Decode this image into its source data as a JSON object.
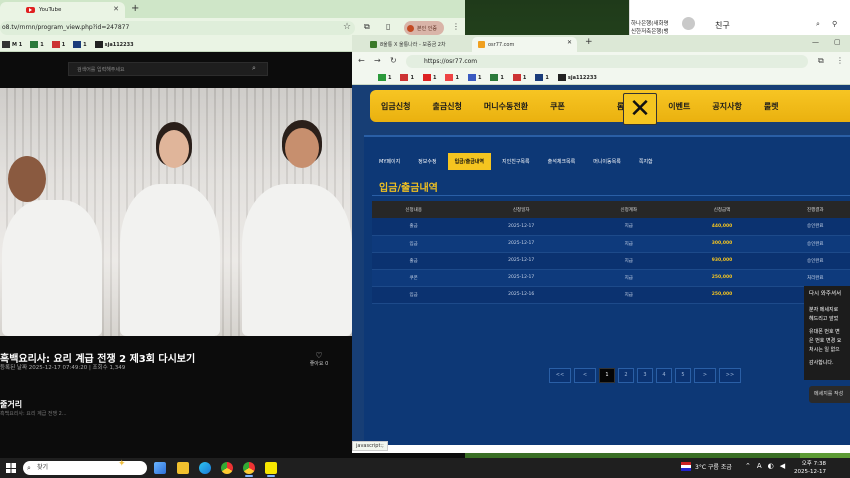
{
  "left_browser": {
    "tab_title": "YouTube",
    "url": "o8.tv/rnrnn/program_view.php?id=247877",
    "profile_pill": "본인 인증",
    "bookmarks": [
      "M 1",
      "1",
      "1",
      "1",
      "sja112233"
    ],
    "search_placeholder": "검색어를 입력해주세요",
    "video_title": "흑백요리사: 요리 계급 전쟁 2 제3회 다시보기",
    "video_meta": "등록된 날짜 2025-12-17 07:49:20 | 조회수 1,349",
    "like_label": "좋아요 0",
    "section_title": "줄거리",
    "section_sub": "흑백요리사: 요리 계급 전쟁 2..."
  },
  "right_browser": {
    "tab1_title": "8울퉁 X 울퉁나라 - 보증금 2차",
    "tab2_title": "osr77.com",
    "url": "https://osr77.com",
    "bookmarks": [
      "1",
      "1",
      "1",
      "1",
      "1",
      "1",
      "1",
      "1",
      "sja112233"
    ],
    "top_menu": [
      "입금신청",
      "출금신청",
      "머니수동전환",
      "쿠폰",
      "",
      "롬프신청",
      "이벤트",
      "공지사항",
      "룰렛"
    ],
    "sub_nav": [
      "MY페이지",
      "정보수정",
      "입금/출금내역",
      "지인친구목록",
      "출석체크목록",
      "머니이동목록",
      "쪽지함"
    ],
    "active_sub": "입금/출금내역",
    "page_title": "입금/출금내역",
    "table_headers": [
      "신청내용",
      "신청일자",
      "신청계좌",
      "신청금액",
      "진행결과"
    ],
    "table_rows": [
      [
        "출금",
        "2025-12-17",
        "지급",
        "440,000",
        "승인완료"
      ],
      [
        "입금",
        "2025-12-17",
        "지급",
        "300,000",
        "승인완료"
      ],
      [
        "출금",
        "2025-12-17",
        "지급",
        "930,000",
        "승인완료"
      ],
      [
        "쿠폰",
        "2025-12-17",
        "지급",
        "250,000",
        "처리완료"
      ],
      [
        "입금",
        "2025-12-16",
        "지급",
        "250,000",
        "승인"
      ]
    ],
    "pager": [
      "<<",
      "<",
      "1",
      "2",
      "3",
      "4",
      "5",
      ">",
      ">>"
    ],
    "current_page": "1",
    "status_text": "javascript:;"
  },
  "chat": {
    "bank_line1": "하나은행(새화명",
    "bank_line2": "신한저축은행(뱅",
    "name": "친구",
    "head": "다시 와주셔서",
    "bubble_lines": [
      "분자 메세지로",
      "헤드리고 앞었",
      "",
      "유대폰 번호 변",
      "은 번호 변경 요",
      "처시는 일 없으",
      "",
      "감사합니다."
    ],
    "input_placeholder": "메세지를 작성"
  },
  "taskbar": {
    "search_label": "찾기",
    "weather": "3°C  구름 조금",
    "time": "오후 7:38",
    "date": "2025-12-17"
  }
}
